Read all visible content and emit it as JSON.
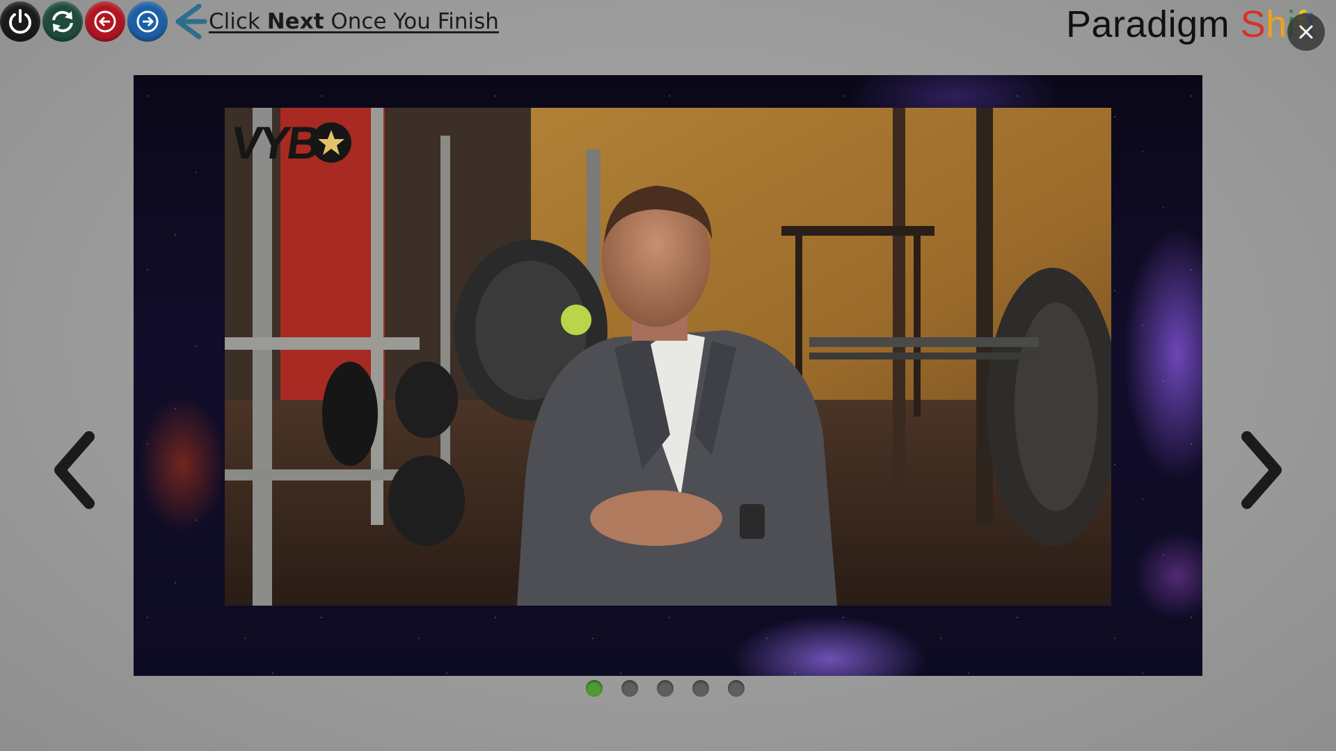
{
  "toolbar": {
    "instruction_prefix": "Click ",
    "instruction_bold": "Next",
    "instruction_suffix": " Once You Finish",
    "buttons": [
      {
        "icon": "power-icon",
        "color": "#1a1a1a"
      },
      {
        "icon": "refresh-icon",
        "color": "#1f4a3e"
      },
      {
        "icon": "previous-circle-icon",
        "color": "#b01622"
      },
      {
        "icon": "next-circle-icon",
        "color": "#1d5fa6"
      }
    ],
    "back_icon": "back-arrow-icon"
  },
  "brand": {
    "word1": "Paradigm",
    "word2_letters": [
      "S",
      "h",
      "i",
      "f",
      "t"
    ]
  },
  "close_icon": "close-icon",
  "slideshow": {
    "video_logo_text": "VYB",
    "video_logo_icon": "star-icon",
    "prev_icon": "chevron-left-icon",
    "next_icon": "chevron-right-icon",
    "total_slides": 5,
    "active_slide": 1
  },
  "colors": {
    "active_dot": "#4f9a32",
    "inactive_dot": "#5e5e5e"
  }
}
